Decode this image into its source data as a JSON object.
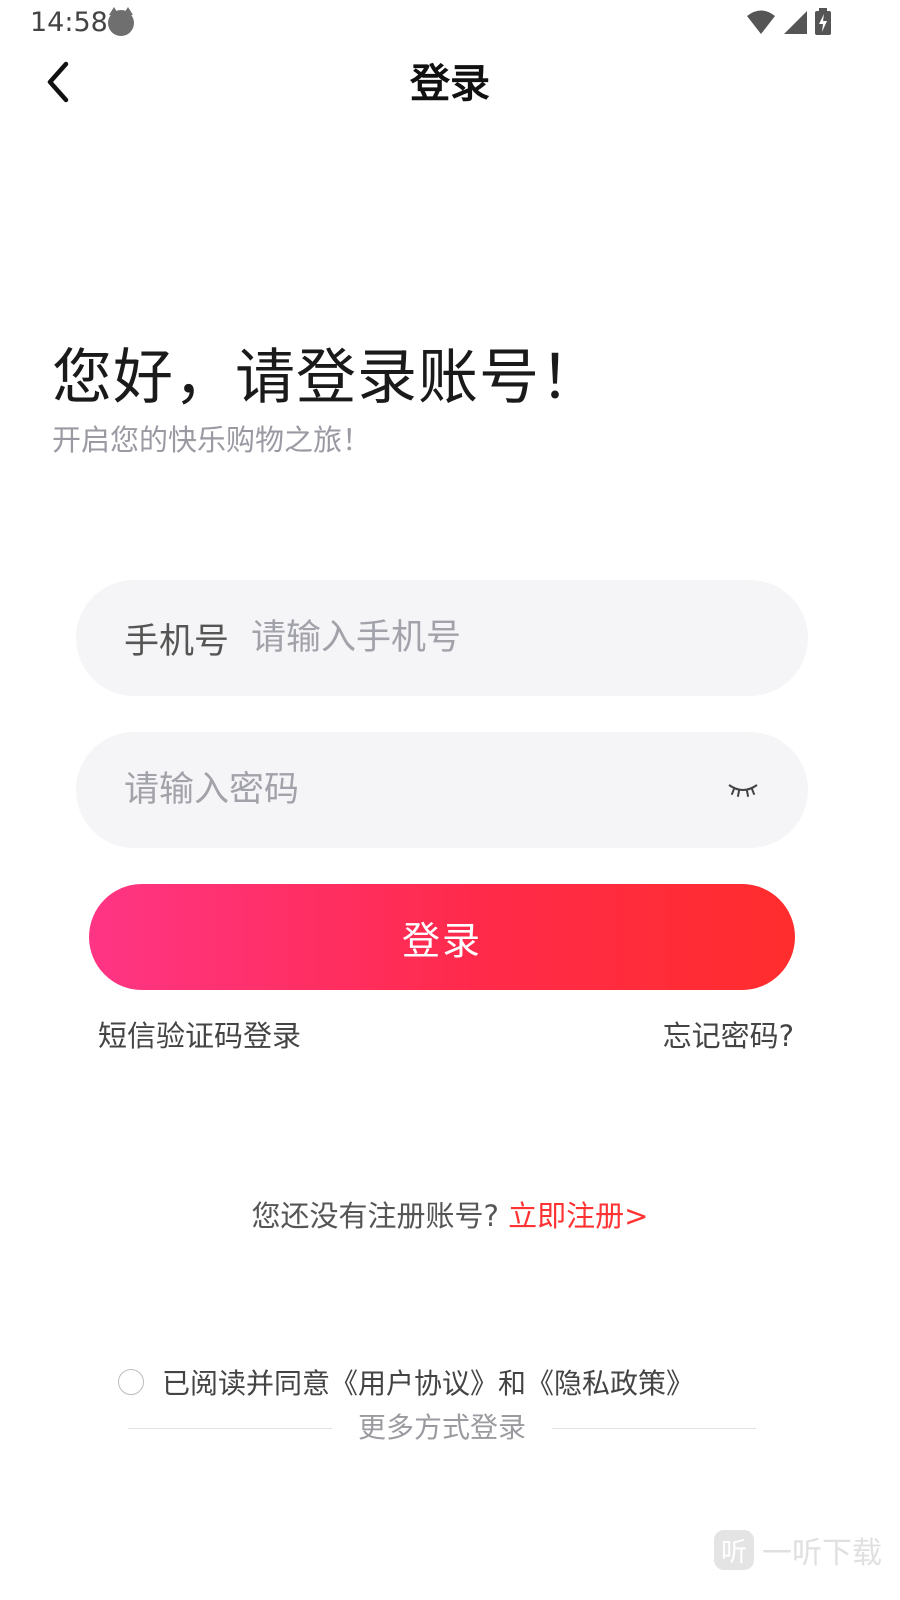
{
  "status_bar": {
    "time": "14:58",
    "icons": [
      "cat-notification-icon",
      "wifi-icon",
      "cell-signal-icon",
      "battery-charging-icon"
    ]
  },
  "header": {
    "title": "登录",
    "back_icon": "chevron-left-icon"
  },
  "greeting": {
    "title": "您好，请登录账号！",
    "subtitle": "开启您的快乐购物之旅！"
  },
  "form": {
    "phone_label": "手机号",
    "phone_placeholder": "请输入手机号",
    "phone_value": "",
    "password_placeholder": "请输入密码",
    "password_value": "",
    "password_toggle_icon": "closed-eye-icon",
    "login_button": "登录"
  },
  "links": {
    "sms_login": "短信验证码登录",
    "forgot_password": "忘记密码?"
  },
  "register": {
    "question": "您还没有注册账号?",
    "link": "立即注册>"
  },
  "agreement": {
    "text": "已阅读并同意《用户协议》和《隐私政策》",
    "checked": false
  },
  "more_login": "更多方式登录",
  "watermark": {
    "icon_char": "听",
    "text": "一听下载"
  },
  "colors": {
    "accent_start": "#ff3585",
    "accent_end": "#ff2d2d",
    "link_red": "#ff3333",
    "field_bg": "#f5f5f7"
  }
}
